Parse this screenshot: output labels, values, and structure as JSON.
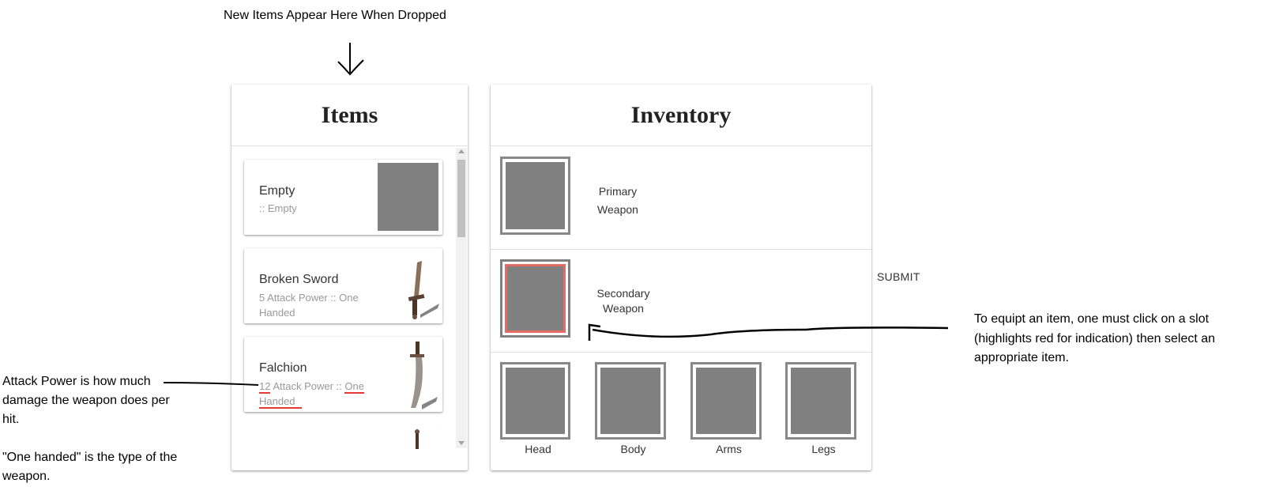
{
  "annotations": {
    "top": "New Items Appear Here When Dropped",
    "left_line1": "Attack Power is how much",
    "left_line2": "damage the weapon does per",
    "left_line3": "hit.",
    "left_line4": "\"One handed\" is the type of the",
    "left_line5": "weapon.",
    "right_line1": "To equipt an item, one must click on a slot",
    "right_line2": "(highlights red for indication) then select an",
    "right_line3": "appropriate item."
  },
  "items_panel": {
    "title": "Items",
    "items": [
      {
        "name": "Empty",
        "sub1": ":: Empty"
      },
      {
        "name": "Broken Sword",
        "sub1": "5 Attack Power :: One",
        "sub2": "Handed"
      },
      {
        "name": "Falchion",
        "sub_num": "12",
        "sub_mid": " Attack Power :: ",
        "sub_one": "One",
        "sub2": "Handed"
      }
    ]
  },
  "inventory_panel": {
    "title": "Inventory",
    "primary_line1": "Primary",
    "primary_line2": "Weapon",
    "secondary_line1": "Secondary",
    "secondary_line2": "Weapon",
    "armor_slots": [
      "Head",
      "Body",
      "Arms",
      "Legs"
    ]
  },
  "submit_label": "SUBMIT",
  "colors": {
    "slot_fill": "#808080",
    "slot_border": "#888888",
    "selected_highlight": "#e46a64",
    "annotation_underline": "#e53935"
  }
}
